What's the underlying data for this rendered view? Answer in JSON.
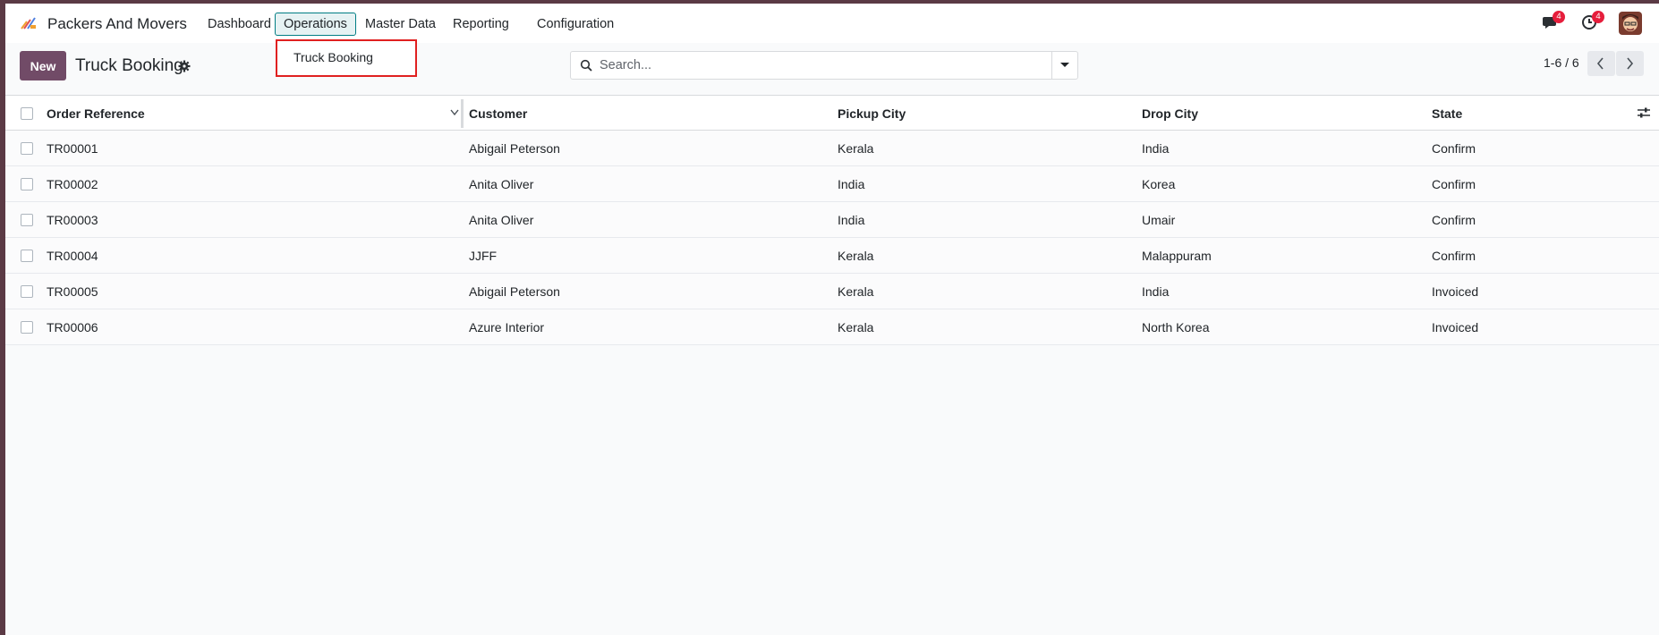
{
  "app": {
    "name": "Packers And Movers"
  },
  "nav": {
    "menus": [
      "Dashboard",
      "Operations",
      "Master Data",
      "Reporting",
      "Configuration"
    ],
    "active_menu": "Operations",
    "messages_count": "4",
    "activities_count": "4"
  },
  "dropdown": {
    "items": [
      "Truck Booking"
    ]
  },
  "control": {
    "new_label": "New",
    "page_title": "Truck Booking",
    "search_placeholder": "Search...",
    "pager_value": "1-6 / 6"
  },
  "table": {
    "columns": [
      "Order Reference",
      "Customer",
      "Pickup City",
      "Drop City",
      "State"
    ],
    "rows": [
      [
        "TR00001",
        "Abigail Peterson",
        "Kerala",
        "India",
        "Confirm"
      ],
      [
        "TR00002",
        "Anita Oliver",
        "India",
        "Korea",
        "Confirm"
      ],
      [
        "TR00003",
        "Anita Oliver",
        "India",
        "Umair",
        "Confirm"
      ],
      [
        "TR00004",
        "JJFF",
        "Kerala",
        "Malappuram",
        "Confirm"
      ],
      [
        "TR00005",
        "Abigail Peterson",
        "Kerala",
        "India",
        "Invoiced"
      ],
      [
        "TR00006",
        "Azure Interior",
        "Kerala",
        "North Korea",
        "Invoiced"
      ]
    ]
  },
  "colors": {
    "brand": "#714b67",
    "accent": "#017e84",
    "badge": "#e61e3c",
    "highlight": "#e02020"
  }
}
